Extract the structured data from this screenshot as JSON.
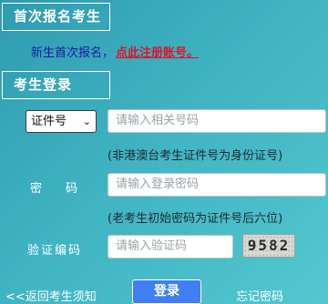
{
  "sections": {
    "new_registration_title": "首次报名考生",
    "login_title": "考生登录"
  },
  "new_registration": {
    "lead_text": "新生首次报名，",
    "register_link": "点此注册账号。"
  },
  "login_form": {
    "id_type_selected": "证件号",
    "id_input_placeholder": "请输入相关号码",
    "id_hint": "(非港澳台考生证件号为身份证号)",
    "password_label": "密　　码",
    "password_placeholder": "请输入登录密码",
    "password_hint": "(老考生初始密码为证件号后六位)",
    "captcha_label": "验证编码",
    "captcha_placeholder": "请输入验证码",
    "captcha_text": "9582"
  },
  "footer": {
    "back_link": "<<返回考生须知",
    "login_button": "登录",
    "forgot_link": "忘记密码"
  },
  "colors": {
    "background_start": "#2f9bb0",
    "background_end": "#52c8cf",
    "register_link": "#e0142a",
    "lead_text": "#1a1aa8",
    "login_button": "#3f7ff3"
  }
}
